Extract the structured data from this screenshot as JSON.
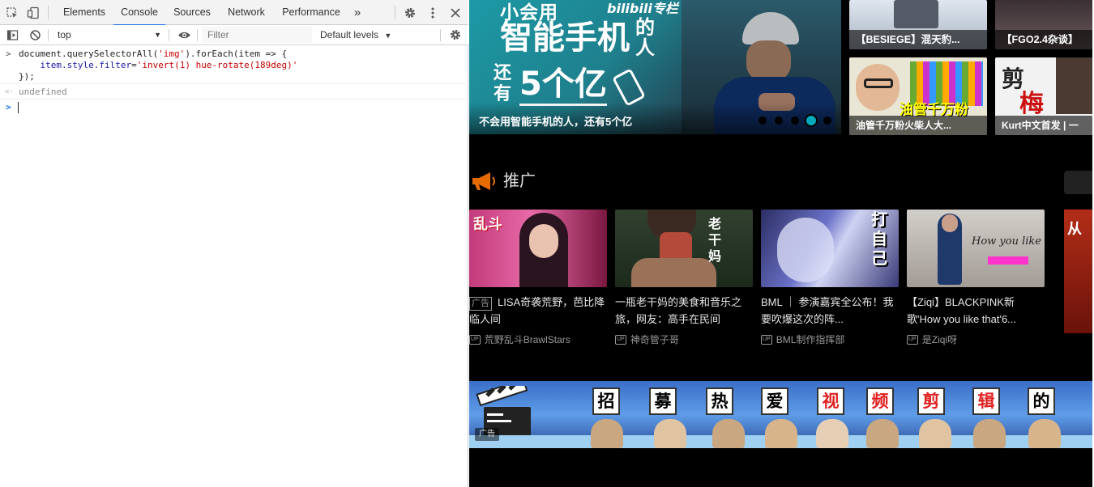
{
  "devtools": {
    "tabs": [
      "Elements",
      "Console",
      "Sources",
      "Network",
      "Performance"
    ],
    "active_tab": "Console",
    "more_tabs": "»",
    "context": "top",
    "filter_placeholder": "Filter",
    "levels": "Default levels",
    "console": {
      "input_prompt": ">",
      "code_line1": "document.querySelectorAll('img').forEach(item => {",
      "code_line2": "    item.style.filter='invert(1) hue-rotate(189deg)'",
      "code_line3": "});",
      "result_prompt": "<·",
      "result": "undefined",
      "next_prompt": ">"
    }
  },
  "page": {
    "banner": {
      "top_text": "小会用",
      "brand": "bilibili专栏",
      "big1": "智能手机",
      "big2": "的人",
      "big3": "还有",
      "big4": "5个亿",
      "caption": "不会用智能手机的人，还有5个亿",
      "dots": 5,
      "active_dot": 4
    },
    "side_thumbs": [
      {
        "title": "【BESIEGE】混天豹..."
      },
      {
        "title": "【FGO2.4杂谈】"
      },
      {
        "title": "油管千万粉火柴人大..."
      },
      {
        "title": "Kurt中文首发 | 一"
      }
    ],
    "thumb_overlays": {
      "oil": "油管千万粉",
      "cut1": "剪",
      "cut2": "梅"
    },
    "promo": {
      "heading": "推广",
      "cards": [
        {
          "ad": "广告",
          "title": "LISA奇袭荒野，芭比降临人间",
          "up": "荒野乱斗BrawlStars",
          "img_text": "乱斗"
        },
        {
          "title": "一瓶老干妈的美食和音乐之旅，网友：高手在民间",
          "up": "神奇管子哥",
          "img_text": "老干妈"
        },
        {
          "title": "BML ｜ 参演嘉宾全公布！我要吹爆这次的阵...",
          "up": "BML制作指挥部",
          "img_text": "打自己"
        },
        {
          "title": "【Ziqi】BLACKPINK新歌'How you like that'6...",
          "up": "是Ziqi呀",
          "img_text": "How you like that"
        }
      ],
      "edge_text": "从",
      "up_badge": "UP"
    },
    "bottom_banner": {
      "chars": [
        "招",
        "募",
        "热",
        "爱",
        "视",
        "频",
        "剪",
        "辑",
        "的"
      ],
      "red_chars": [
        false,
        false,
        false,
        false,
        true,
        true,
        true,
        true,
        false
      ],
      "ad": "广告"
    }
  }
}
